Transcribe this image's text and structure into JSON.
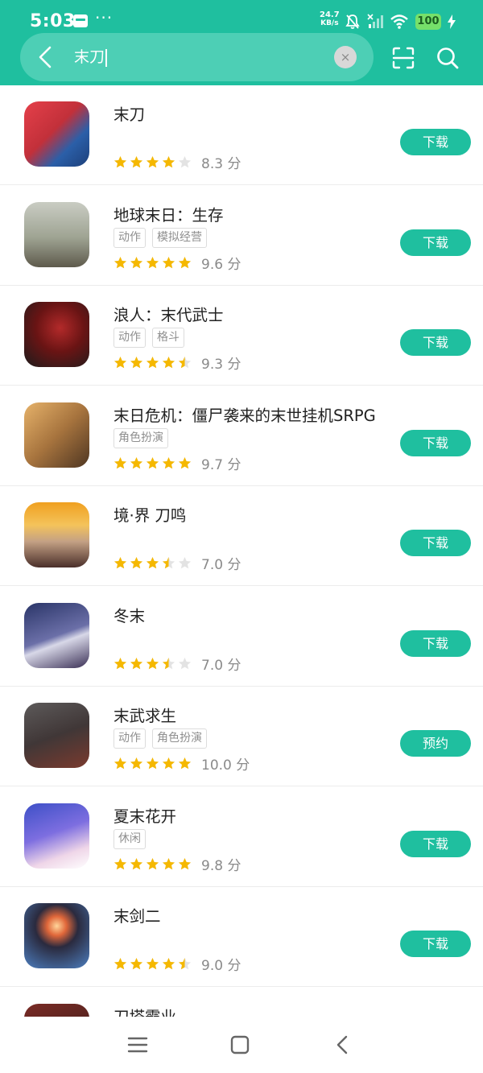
{
  "status": {
    "time": "5:03",
    "dots": "···",
    "speed_value": "24.7",
    "speed_unit": "KB/s",
    "battery": "100"
  },
  "search": {
    "query": "末刀",
    "clear_label": "×"
  },
  "rating_unit": "分",
  "apps": [
    {
      "name": "末刀",
      "tags": [],
      "stars": 4,
      "score": "8.3",
      "action": "下载",
      "icon": "blade-warrior-icon"
    },
    {
      "name": "地球末日：生存",
      "tags": [
        "动作",
        "模拟经营"
      ],
      "stars": 5,
      "score": "9.6",
      "action": "下载",
      "icon": "survivor-icon"
    },
    {
      "name": "浪人：末代武士",
      "tags": [
        "动作",
        "格斗"
      ],
      "stars": 4.5,
      "score": "9.3",
      "action": "下载",
      "icon": "ronin-icon"
    },
    {
      "name": "末日危机：僵尸袭来的末世挂机SRPG",
      "tags": [
        "角色扮演"
      ],
      "stars": 5,
      "score": "9.7",
      "action": "下载",
      "icon": "soldier-icon"
    },
    {
      "name": "境·界 刀鸣",
      "tags": [],
      "stars": 3.5,
      "score": "7.0",
      "action": "下载",
      "icon": "anime-hero-icon"
    },
    {
      "name": "冬末",
      "tags": [],
      "stars": 3.5,
      "score": "7.0",
      "action": "下载",
      "icon": "hooded-girl-icon"
    },
    {
      "name": "末武求生",
      "tags": [
        "动作",
        "角色扮演"
      ],
      "stars": 5,
      "score": "10.0",
      "action": "预约",
      "icon": "swordsman-icon"
    },
    {
      "name": "夏末花开",
      "tags": [
        "休闲"
      ],
      "stars": 5,
      "score": "9.8",
      "action": "下载",
      "icon": "anime-girl-icon"
    },
    {
      "name": "末剑二",
      "tags": [],
      "stars": 4.5,
      "score": "9.0",
      "action": "下载",
      "icon": "eclipse-tower-icon"
    },
    {
      "name": "刀塔霸业",
      "tags": [],
      "stars": 0,
      "score": "",
      "action": "",
      "icon": "dota-icon"
    }
  ],
  "colors": {
    "accent": "#1fbf9f",
    "star": "#f5b800",
    "star_empty": "#e3e3e3"
  }
}
